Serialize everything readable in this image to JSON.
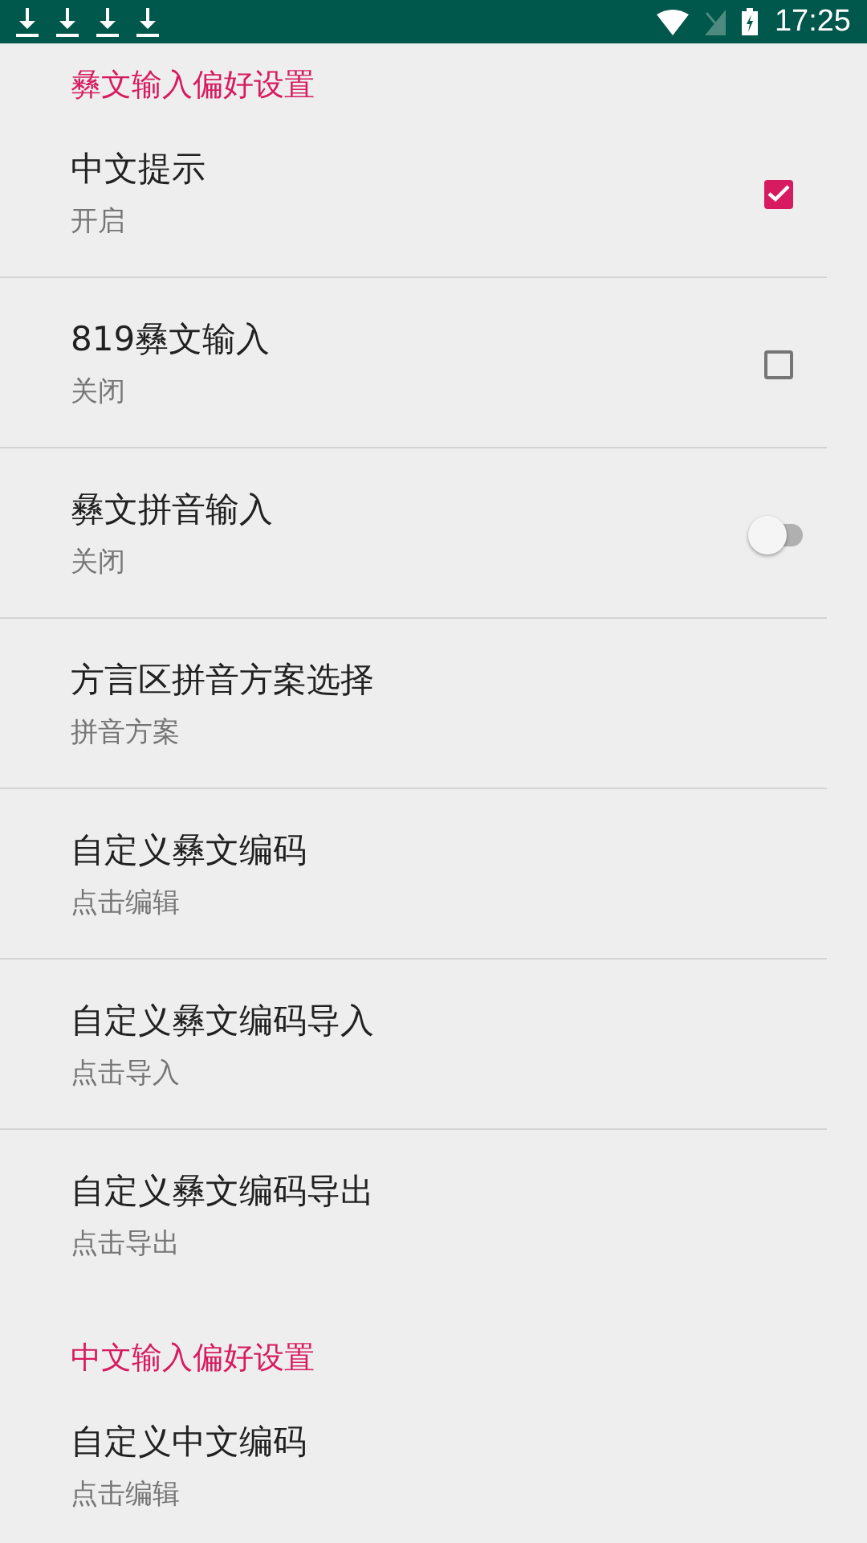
{
  "status_bar": {
    "time": "17:25"
  },
  "sections": [
    {
      "title": "彝文输入偏好设置",
      "items": [
        {
          "title": "中文提示",
          "summary": "开启",
          "kind": "checkbox",
          "checked": true
        },
        {
          "title": "819彝文输入",
          "summary": "关闭",
          "kind": "checkbox",
          "checked": false
        },
        {
          "title": "彝文拼音输入",
          "summary": "关闭",
          "kind": "switch",
          "on": false
        },
        {
          "title": "方言区拼音方案选择",
          "summary": "拼音方案",
          "kind": "plain"
        },
        {
          "title": "自定义彝文编码",
          "summary": "点击编辑",
          "kind": "plain"
        },
        {
          "title": "自定义彝文编码导入",
          "summary": "点击导入",
          "kind": "plain"
        },
        {
          "title": "自定义彝文编码导出",
          "summary": "点击导出",
          "kind": "plain"
        }
      ]
    },
    {
      "title": "中文输入偏好设置",
      "items": [
        {
          "title": "自定义中文编码",
          "summary": "点击编辑",
          "kind": "plain"
        }
      ]
    }
  ]
}
